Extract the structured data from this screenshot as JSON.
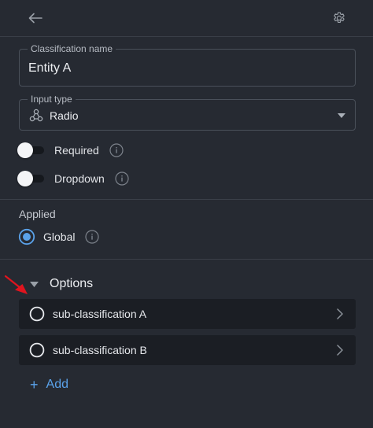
{
  "fields": {
    "classification_name": {
      "label": "Classification name",
      "value": "Entity A"
    },
    "input_type": {
      "label": "Input type",
      "value": "Radio"
    }
  },
  "toggles": {
    "required": {
      "label": "Required",
      "on": false
    },
    "dropdown": {
      "label": "Dropdown",
      "on": false
    }
  },
  "applied": {
    "title": "Applied",
    "selected": "Global"
  },
  "options": {
    "title": "Options",
    "items": [
      {
        "label": "sub-classification A"
      },
      {
        "label": "sub-classification B"
      }
    ],
    "add_label": "Add"
  },
  "colors": {
    "background": "#262a32",
    "item_background": "#1b1e24",
    "accent": "#5aa2ea",
    "annotation_arrow": "#e0141e"
  },
  "icons": {
    "back": "arrow-left-icon",
    "settings": "gear-icon",
    "input_type": "radio-network-icon",
    "info": "info-icon",
    "caret": "caret-down-icon",
    "chevron": "chevron-right-icon"
  }
}
